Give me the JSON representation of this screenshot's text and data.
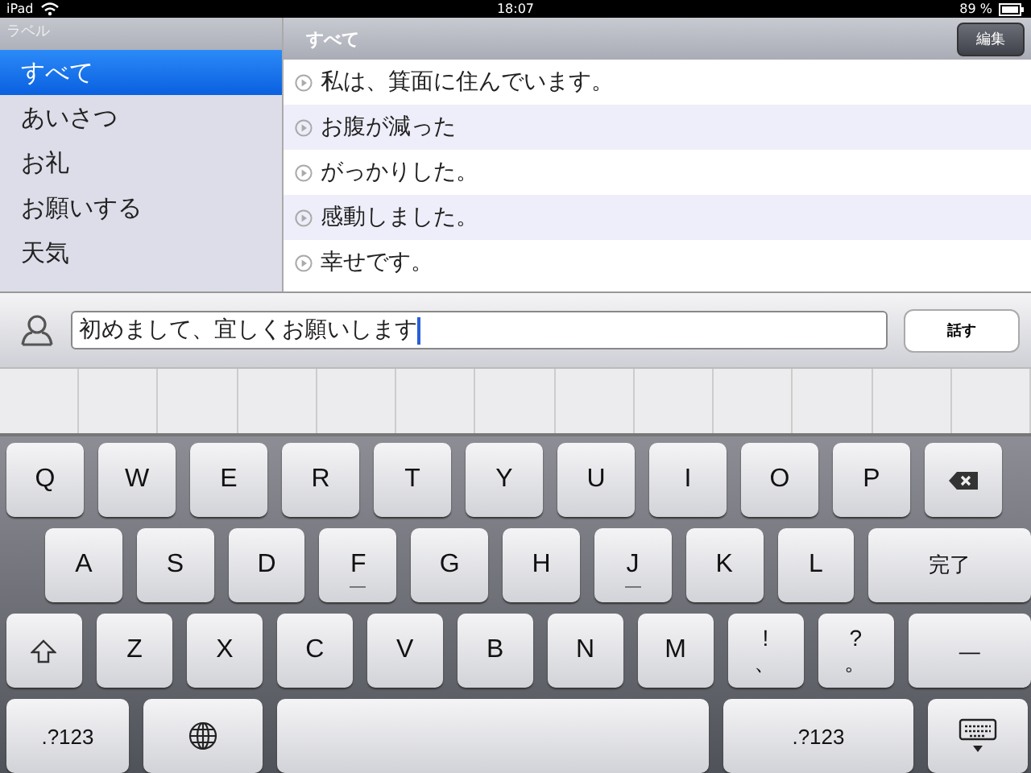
{
  "status_bar": {
    "device": "iPad",
    "time": "18:07",
    "battery": "89 %"
  },
  "sidebar": {
    "header": "ラベル",
    "items": [
      {
        "label": "すべて",
        "selected": true
      },
      {
        "label": "あいさつ",
        "selected": false
      },
      {
        "label": "お礼",
        "selected": false
      },
      {
        "label": "お願いする",
        "selected": false
      },
      {
        "label": "天気",
        "selected": false
      }
    ]
  },
  "content": {
    "title": "すべて",
    "edit_button": "編集",
    "phrases": [
      "私は、箕面に住んでいます。",
      "お腹が減った",
      "がっかりした。",
      "感動しました。",
      "幸せです。"
    ]
  },
  "input_bar": {
    "value": "初めまして、宜しくお願いします",
    "speak_button": "話す"
  },
  "keyboard": {
    "rows": [
      [
        {
          "kind": "char",
          "label": "Q"
        },
        {
          "kind": "char",
          "label": "W"
        },
        {
          "kind": "char",
          "label": "E"
        },
        {
          "kind": "char",
          "label": "R"
        },
        {
          "kind": "char",
          "label": "T"
        },
        {
          "kind": "char",
          "label": "Y"
        },
        {
          "kind": "char",
          "label": "U"
        },
        {
          "kind": "char",
          "label": "I"
        },
        {
          "kind": "char",
          "label": "O"
        },
        {
          "kind": "char",
          "label": "P"
        },
        {
          "kind": "delete"
        }
      ],
      [
        {
          "kind": "char",
          "label": "A"
        },
        {
          "kind": "char",
          "label": "S"
        },
        {
          "kind": "char",
          "label": "D"
        },
        {
          "kind": "char",
          "label": "F",
          "home_key": true
        },
        {
          "kind": "char",
          "label": "G"
        },
        {
          "kind": "char",
          "label": "H"
        },
        {
          "kind": "char",
          "label": "J",
          "home_key": true
        },
        {
          "kind": "char",
          "label": "K"
        },
        {
          "kind": "char",
          "label": "L"
        },
        {
          "kind": "wide",
          "label": "完了"
        }
      ],
      [
        {
          "kind": "shift"
        },
        {
          "kind": "char",
          "label": "Z"
        },
        {
          "kind": "char",
          "label": "X"
        },
        {
          "kind": "char",
          "label": "C"
        },
        {
          "kind": "char",
          "label": "V"
        },
        {
          "kind": "char",
          "label": "B"
        },
        {
          "kind": "char",
          "label": "N"
        },
        {
          "kind": "char",
          "label": "M"
        },
        {
          "kind": "dual",
          "label": "!",
          "sub": "、"
        },
        {
          "kind": "dual",
          "label": "?",
          "sub": "。"
        },
        {
          "kind": "wide",
          "label": "—"
        }
      ],
      [
        {
          "kind": "mode",
          "label": ".?123"
        },
        {
          "kind": "globe"
        },
        {
          "kind": "space"
        },
        {
          "kind": "mode2",
          "label": ".?123"
        },
        {
          "kind": "hide"
        }
      ]
    ]
  }
}
